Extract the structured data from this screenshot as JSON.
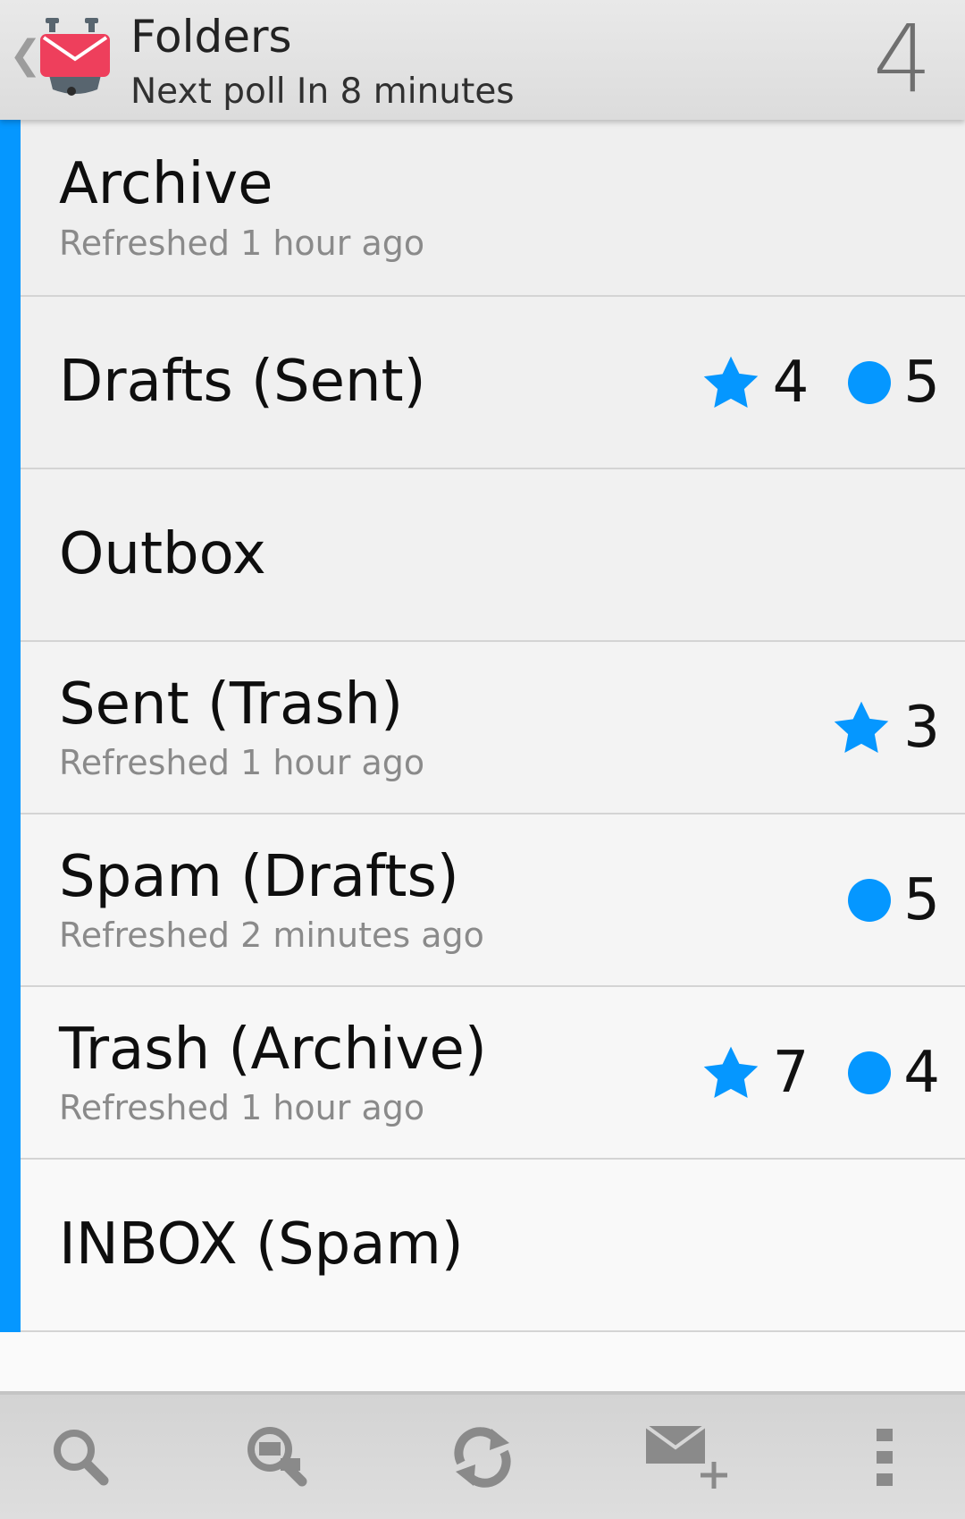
{
  "header": {
    "title": "Folders",
    "subtitle": "Next poll In 8 minutes",
    "count": "4",
    "back_icon": "chevron-left-icon",
    "app_icon": "k9-mail-logo-icon"
  },
  "colors": {
    "accent": "#0597ff",
    "header_bg": "#e2e2e2",
    "toolbar_bg": "#d8d8d8"
  },
  "folders": [
    {
      "name": "Archive",
      "status": "Refreshed 1 hour ago",
      "flagged": "",
      "unread": ""
    },
    {
      "name": "Drafts (Sent)",
      "status": "",
      "flagged": "4",
      "unread": "5"
    },
    {
      "name": "Outbox",
      "status": "",
      "flagged": "",
      "unread": ""
    },
    {
      "name": "Sent (Trash)",
      "status": "Refreshed 1 hour ago",
      "flagged": "3",
      "unread": ""
    },
    {
      "name": "Spam (Drafts)",
      "status": "Refreshed 2 minutes ago",
      "flagged": "",
      "unread": "5"
    },
    {
      "name": "Trash (Archive)",
      "status": "Refreshed 1 hour ago",
      "flagged": "7",
      "unread": "4"
    },
    {
      "name": "INBOX (Spam)",
      "status": "",
      "flagged": "",
      "unread": ""
    }
  ],
  "toolbar": {
    "items": [
      {
        "icon": "search-icon"
      },
      {
        "icon": "search-everywhere-icon"
      },
      {
        "icon": "refresh-icon"
      },
      {
        "icon": "compose-icon"
      },
      {
        "icon": "overflow-menu-icon"
      }
    ]
  }
}
